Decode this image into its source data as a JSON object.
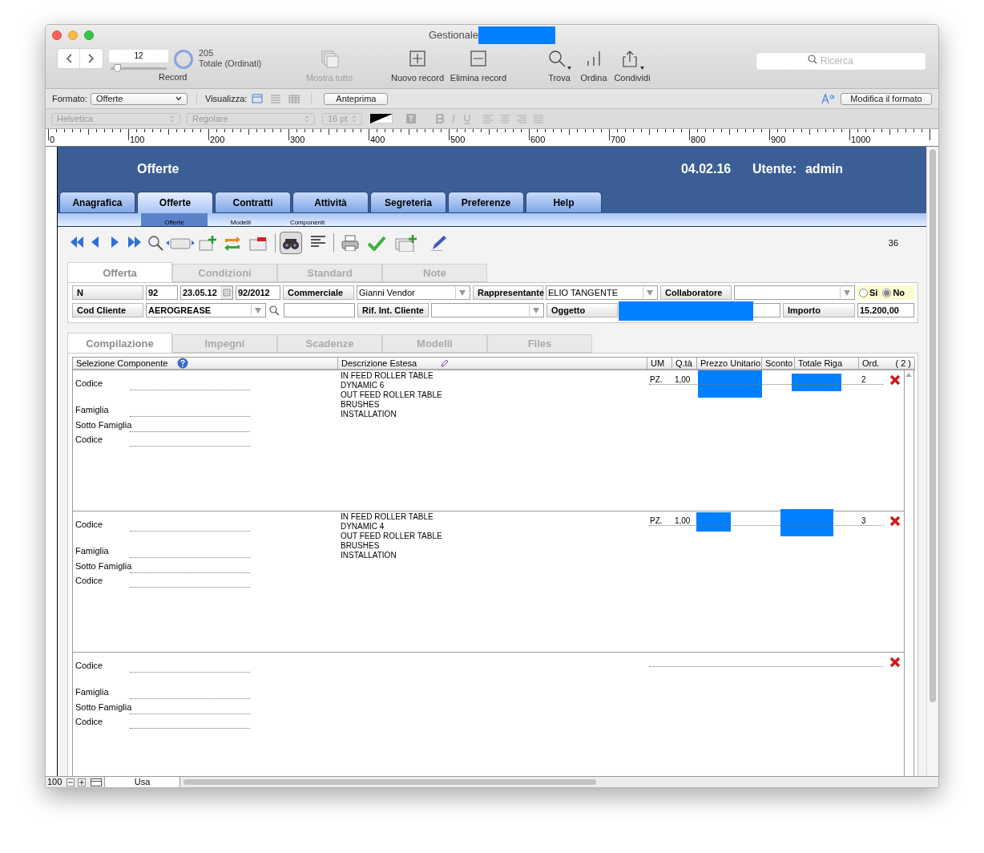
{
  "window": {
    "title": "Gestionale",
    "title_redacted": true
  },
  "toolbar": {
    "record_number": "12",
    "record_slider": {
      "level": 0.05
    },
    "total_count": "205",
    "total_label": "Totale (Ordinati)",
    "record_label": "Record",
    "buttons": [
      {
        "kind": "show_all",
        "label": "Mostra tutto",
        "disabled": true,
        "has_menu": false
      },
      {
        "kind": "new",
        "label": "Nuovo record",
        "disabled": false,
        "has_menu": false
      },
      {
        "kind": "delete",
        "label": "Elimina record",
        "disabled": false,
        "has_menu": false
      },
      {
        "kind": "find",
        "label": "Trova",
        "disabled": false,
        "has_menu": true
      },
      {
        "kind": "sort",
        "label": "Ordina",
        "disabled": false,
        "has_menu": false
      },
      {
        "kind": "share",
        "label": "Condividi",
        "disabled": false,
        "has_menu": true
      }
    ],
    "search_placeholder": "Ricerca"
  },
  "layout_bar": {
    "format_label": "Formato:",
    "format_value": "Offerte",
    "view_label": "Visualizza:",
    "view_modes": [
      {
        "kind": "form",
        "selected": true
      },
      {
        "kind": "list",
        "selected": false
      },
      {
        "kind": "table",
        "selected": false
      }
    ],
    "preview_button": "Anteprima",
    "edit_layout_button": "Modifica il formato"
  },
  "text_format_bar": {
    "disabled": true,
    "font": "Helvetica",
    "style": "Regolare",
    "size": "16 pt"
  },
  "ruler": {
    "labels": [
      "0",
      "100",
      "200",
      "300",
      "400",
      "500",
      "600",
      "700",
      "800",
      "900",
      "1000"
    ]
  },
  "app_header": {
    "title": "Offerte",
    "date": "04.02.16",
    "user_label": "Utente:",
    "user": "admin"
  },
  "main_tabs": [
    {
      "label": "Anagrafica",
      "selected": false
    },
    {
      "label": "Offerte",
      "selected": true
    },
    {
      "label": "Contratti",
      "selected": false
    },
    {
      "label": "Attività",
      "selected": false
    },
    {
      "label": "Segreteria",
      "selected": false
    },
    {
      "label": "Preferenze",
      "selected": false
    },
    {
      "label": "Help",
      "selected": false
    }
  ],
  "sub_tabs": [
    {
      "label": "Offerte",
      "selected": true
    },
    {
      "label": "Modelli",
      "selected": false
    },
    {
      "label": "Componenti",
      "selected": false
    }
  ],
  "record_count": "36",
  "form_tabs": [
    {
      "label": "Offerta",
      "selected": true
    },
    {
      "label": "Condizioni",
      "selected": false
    },
    {
      "label": "Standard",
      "selected": false
    },
    {
      "label": "Note",
      "selected": false
    }
  ],
  "form": {
    "rows": [
      {
        "items": [
          {
            "kind": "label",
            "text": "N"
          },
          {
            "kind": "field",
            "value": "92",
            "bold": true
          },
          {
            "kind": "date",
            "value": "23.05.12",
            "bold": true
          },
          {
            "kind": "field",
            "value": "92/2012",
            "bold": true
          },
          {
            "kind": "label",
            "text": "Commerciale"
          },
          {
            "kind": "dropdown",
            "value": "Gianni Vendor",
            "bold": false
          },
          {
            "kind": "label",
            "text": "Rappresentante"
          },
          {
            "kind": "dropdown",
            "value": "ELIO TANGENTE",
            "bold": false
          },
          {
            "kind": "label",
            "text": "Collaboratore"
          },
          {
            "kind": "dropdown"
          },
          {
            "kind": "radio_group",
            "options": [
              {
                "label": "Si",
                "selected": false
              },
              {
                "label": "No",
                "selected": true
              }
            ]
          }
        ]
      },
      {
        "items": [
          {
            "kind": "label",
            "text": "Cod Cliente"
          },
          {
            "kind": "dropdown",
            "value": "AEROGREASE",
            "bold": true
          },
          {
            "kind": "lookup"
          },
          {
            "kind": "field"
          },
          {
            "kind": "label",
            "text": "Rif. Int. Cliente"
          },
          {
            "kind": "dropdown"
          },
          {
            "kind": "label",
            "text": "Oggetto"
          },
          {
            "kind": "field",
            "redacted": true
          },
          {
            "kind": "label",
            "text": "Importo"
          },
          {
            "kind": "field",
            "value": "15.200,00",
            "bold": true
          }
        ]
      }
    ]
  },
  "lines_tabs": [
    {
      "label": "Compilazione",
      "selected": true
    },
    {
      "label": "Impegni",
      "selected": false
    },
    {
      "label": "Scadenze",
      "selected": false
    },
    {
      "label": "Modelli",
      "selected": false
    },
    {
      "label": "Files",
      "selected": false
    }
  ],
  "lines_table": {
    "columns": [
      "Selezione Componente",
      "Descrizione Estesa",
      "UM",
      "Q.tà",
      "Prezzo Unitario",
      "Sconto",
      "Totale Riga",
      "Ord."
    ],
    "count": "( 2 )",
    "rows": [
      {
        "field_labels": [
          "Codice",
          "Famiglia",
          "Sotto Famiglia",
          "Codice"
        ],
        "description_lines": [
          "IN FEED ROLLER TABLE",
          "DYNAMIC 6",
          "OUT FEED ROLLER TABLE",
          "BRUSHES",
          "INSTALLATION"
        ],
        "um": "PZ.",
        "qty": "1,00",
        "price_redacted": true,
        "total_redacted": true,
        "ord": "2"
      },
      {
        "field_labels": [
          "Codice",
          "Famiglia",
          "Sotto Famiglia",
          "Codice"
        ],
        "description_lines": [
          "IN FEED ROLLER TABLE",
          "DYNAMIC 4",
          "OUT FEED ROLLER TABLE",
          "BRUSHES",
          "INSTALLATION"
        ],
        "um": "PZ.",
        "qty": "1,00",
        "price_redacted": true,
        "total_redacted": true,
        "ord": "3"
      },
      {
        "field_labels": [
          "Codice",
          "Famiglia",
          "Sotto Famiglia",
          "Codice"
        ]
      }
    ]
  },
  "status_bar": {
    "zoom": "100",
    "mode": "Usa"
  }
}
